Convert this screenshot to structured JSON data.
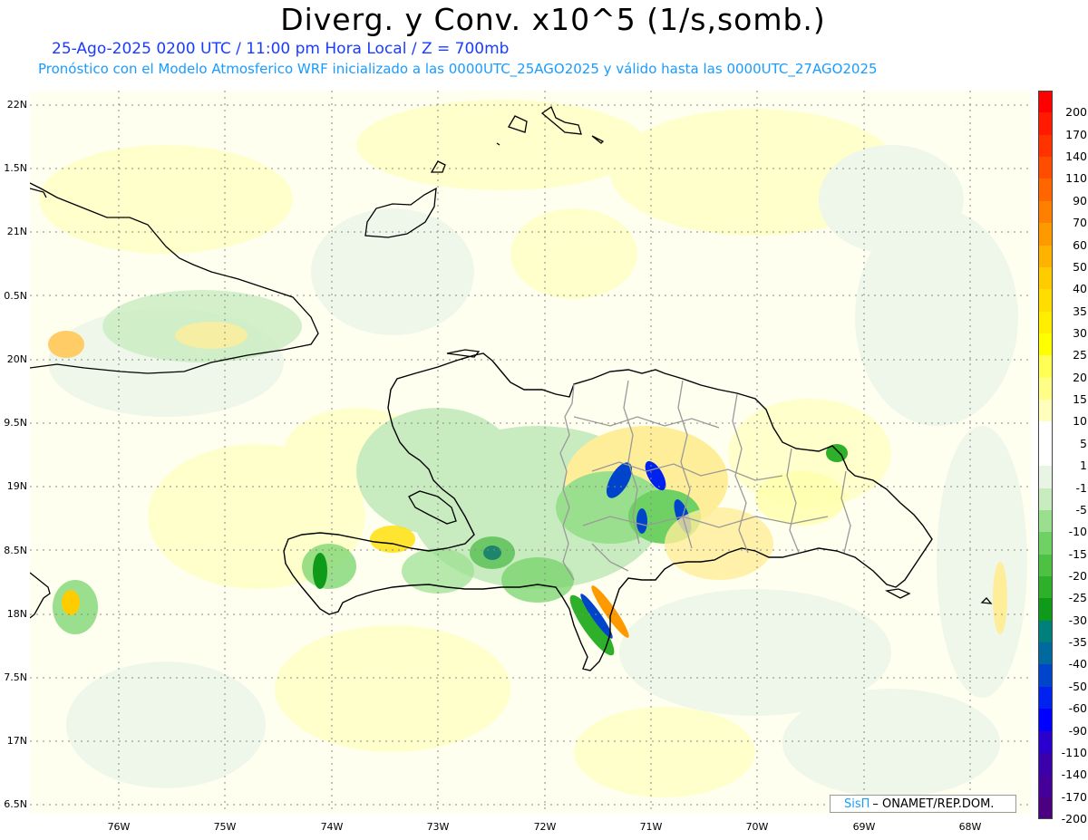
{
  "header": {
    "title": "Diverg. y Conv. x10^5 (1/s,somb.)",
    "subtitle": "25-Ago-2025  0200 UTC / 11:00 pm Hora Local / Z = 700mb",
    "validity": "Pronóstico con el Modelo Atmosferico WRF inicializado a las 0000UTC_25AGO2025 y válido hasta las  0000UTC_27AGO2025"
  },
  "map": {
    "lat_labels": [
      "22N",
      "1.5N",
      "21N",
      "0.5N",
      "20N",
      "9.5N",
      "19N",
      "8.5N",
      "18N",
      "7.5N",
      "17N",
      "6.5N"
    ],
    "lon_labels": [
      "76W",
      "75W",
      "74W",
      "73W",
      "72W",
      "71W",
      "70W",
      "69W",
      "68W"
    ]
  },
  "legend": {
    "labels": [
      "200",
      "170",
      "140",
      "110",
      "90",
      "70",
      "60",
      "50",
      "40",
      "35",
      "30",
      "25",
      "20",
      "15",
      "10",
      "5",
      "1",
      "-1",
      "-5",
      "-10",
      "-15",
      "-20",
      "-25",
      "-30",
      "-35",
      "-40",
      "-50",
      "-60",
      "-90",
      "-110",
      "-140",
      "-170",
      "-200"
    ],
    "colors": [
      "#ff0000",
      "#ff1a00",
      "#ff3300",
      "#ff4d00",
      "#ff6600",
      "#ff8000",
      "#ff9900",
      "#ffb300",
      "#ffcc00",
      "#ffdd00",
      "#ffee00",
      "#ffff00",
      "#ffff55",
      "#ffff88",
      "#ffffbb",
      "#ffffff",
      "#ffffff",
      "#e8f5e4",
      "#c8ecc0",
      "#9adf8e",
      "#6fd164",
      "#4cc143",
      "#2eb02a",
      "#0f9a1a",
      "#00807a",
      "#006aa0",
      "#0044cc",
      "#0022ee",
      "#0000ff",
      "#2a00cc",
      "#3a00aa",
      "#440099",
      "#4b0082"
    ]
  },
  "credit": {
    "logo": "SisΠ",
    "org": "– ONAMET/REP.DOM."
  },
  "colors": {
    "grid": "#888888",
    "coast": "#000000",
    "province": "#999999",
    "div_yellow": "#ffffbb",
    "div_yellow_strong": "#ffee66",
    "conv_green_light": "#e8f5e4",
    "conv_green": "#9adf8e",
    "conv_green_dark": "#2eb02a",
    "conv_blue": "#0044cc"
  }
}
